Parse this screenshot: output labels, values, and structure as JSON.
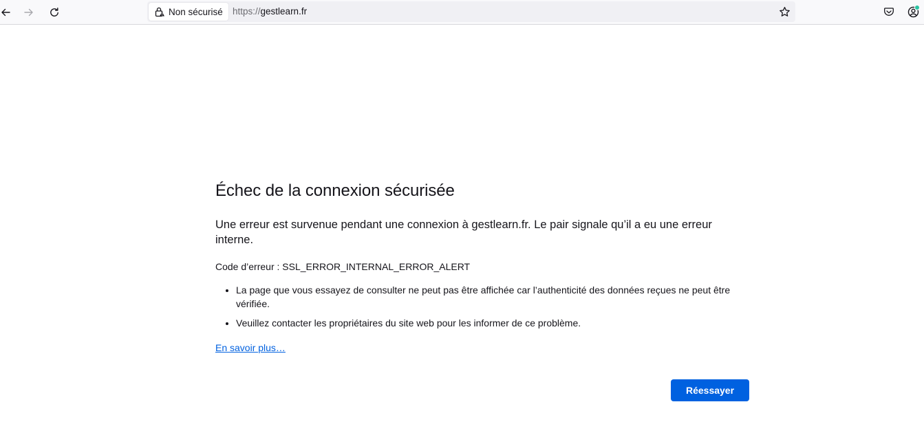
{
  "browser": {
    "identity_label": "Non sécurisé",
    "url_scheme": "https://",
    "url_host": "gestlearn.fr",
    "icons": {
      "back": "back-arrow-icon",
      "forward": "forward-arrow-icon",
      "reload": "reload-icon",
      "lock": "insecure-lock-icon",
      "bookmark": "star-icon",
      "pocket": "pocket-icon",
      "account": "account-icon"
    },
    "notification_dot_color": "#2ac3a2"
  },
  "error": {
    "title": "Échec de la connexion sécurisée",
    "intro": "Une erreur est survenue pendant une connexion à gestlearn.fr. Le pair signale qu’il a eu une erreur interne.",
    "code_label": "Code d’erreur : ",
    "code_value": "SSL_ERROR_INTERNAL_ERROR_ALERT",
    "details": [
      "La page que vous essayez de consulter ne peut pas être affichée car l’authenticité des données reçues ne peut être vérifiée.",
      "Veuillez contacter les propriétaires du site web pour les informer de ce problème."
    ],
    "learn_more": "En savoir plus…",
    "retry_label": "Réessayer"
  },
  "colors": {
    "accent": "#0061e0",
    "toolbar_bg": "#f9f9fb",
    "urlbar_bg": "#f0f0f4",
    "text": "#15141a"
  }
}
